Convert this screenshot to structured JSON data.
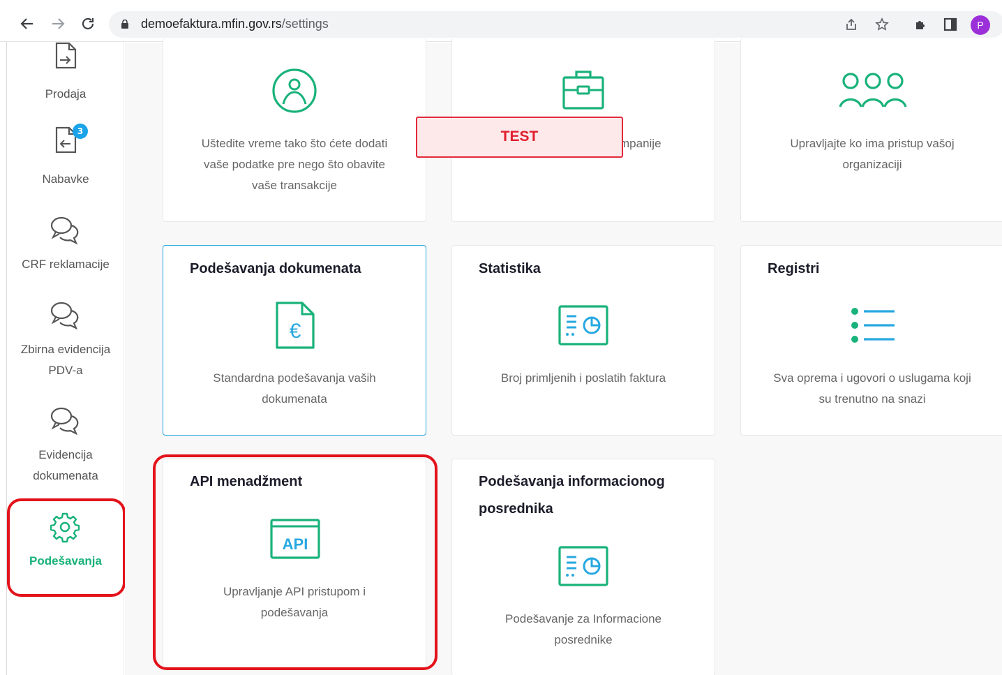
{
  "browser": {
    "url_host": "demoefaktura.mfin.gov.rs",
    "url_path": "/settings",
    "profile_initial": "P"
  },
  "sidebar": {
    "items": [
      {
        "label": "Prodaja",
        "icon": "document-arrow-right-icon"
      },
      {
        "label": "Nabavke",
        "icon": "document-arrow-left-icon",
        "badge": "3"
      },
      {
        "label": "CRF reklamacije",
        "icon": "chat-bubbles-icon"
      },
      {
        "label_line1": "Zbirna evidencija",
        "label_line2": "PDV-a",
        "icon": "chat-bubbles-icon"
      },
      {
        "label_line1": "Evidencija",
        "label_line2": "dokumenata",
        "icon": "chat-bubbles-icon"
      },
      {
        "label": "Podešavanja",
        "icon": "gear-icon",
        "active": true
      }
    ]
  },
  "banner": {
    "text": "TEST"
  },
  "cards": {
    "profile": {
      "desc_l1": "Uštedite vreme tako što ćete dodati",
      "desc_l2": "vaše podatke pre nego što obavite",
      "desc_l3": "vaše transakcije",
      "icon": "user-circle-icon"
    },
    "company": {
      "desc_partial": "mpanije",
      "icon": "briefcase-icon"
    },
    "users": {
      "desc_l1": "Upravljajte ko ima pristup vašoj",
      "desc_l2": "organizaciji",
      "icon": "users-group-icon"
    },
    "documents": {
      "title": "Podešavanja dokumenata",
      "desc_l1": "Standardna podešavanja vaših",
      "desc_l2": "dokumenata",
      "icon": "euro-document-icon"
    },
    "statistics": {
      "title": "Statistika",
      "desc_l1": "Broj primljenih i poslatih faktura",
      "icon": "stats-report-icon"
    },
    "registers": {
      "title": "Registri",
      "desc_l1": "Sva oprema i ugovori o uslugama koji",
      "desc_l2": "su trenutno na snazi",
      "icon": "list-icon"
    },
    "api": {
      "title": "API menadžment",
      "icon_text": "API",
      "desc_l1": "Upravljanje API pristupom i",
      "desc_l2": "podešavanja",
      "icon": "api-window-icon"
    },
    "intermediary": {
      "title_l1": "Podešavanja informacionog",
      "title_l2": "posrednika",
      "desc_l1": "Podešavanje za Informacione",
      "desc_l2": "posrednike",
      "icon": "stats-report-icon"
    }
  },
  "colors": {
    "accent_green": "#19b27a",
    "accent_blue": "#27a8e0",
    "highlight_red": "#e3131b"
  }
}
